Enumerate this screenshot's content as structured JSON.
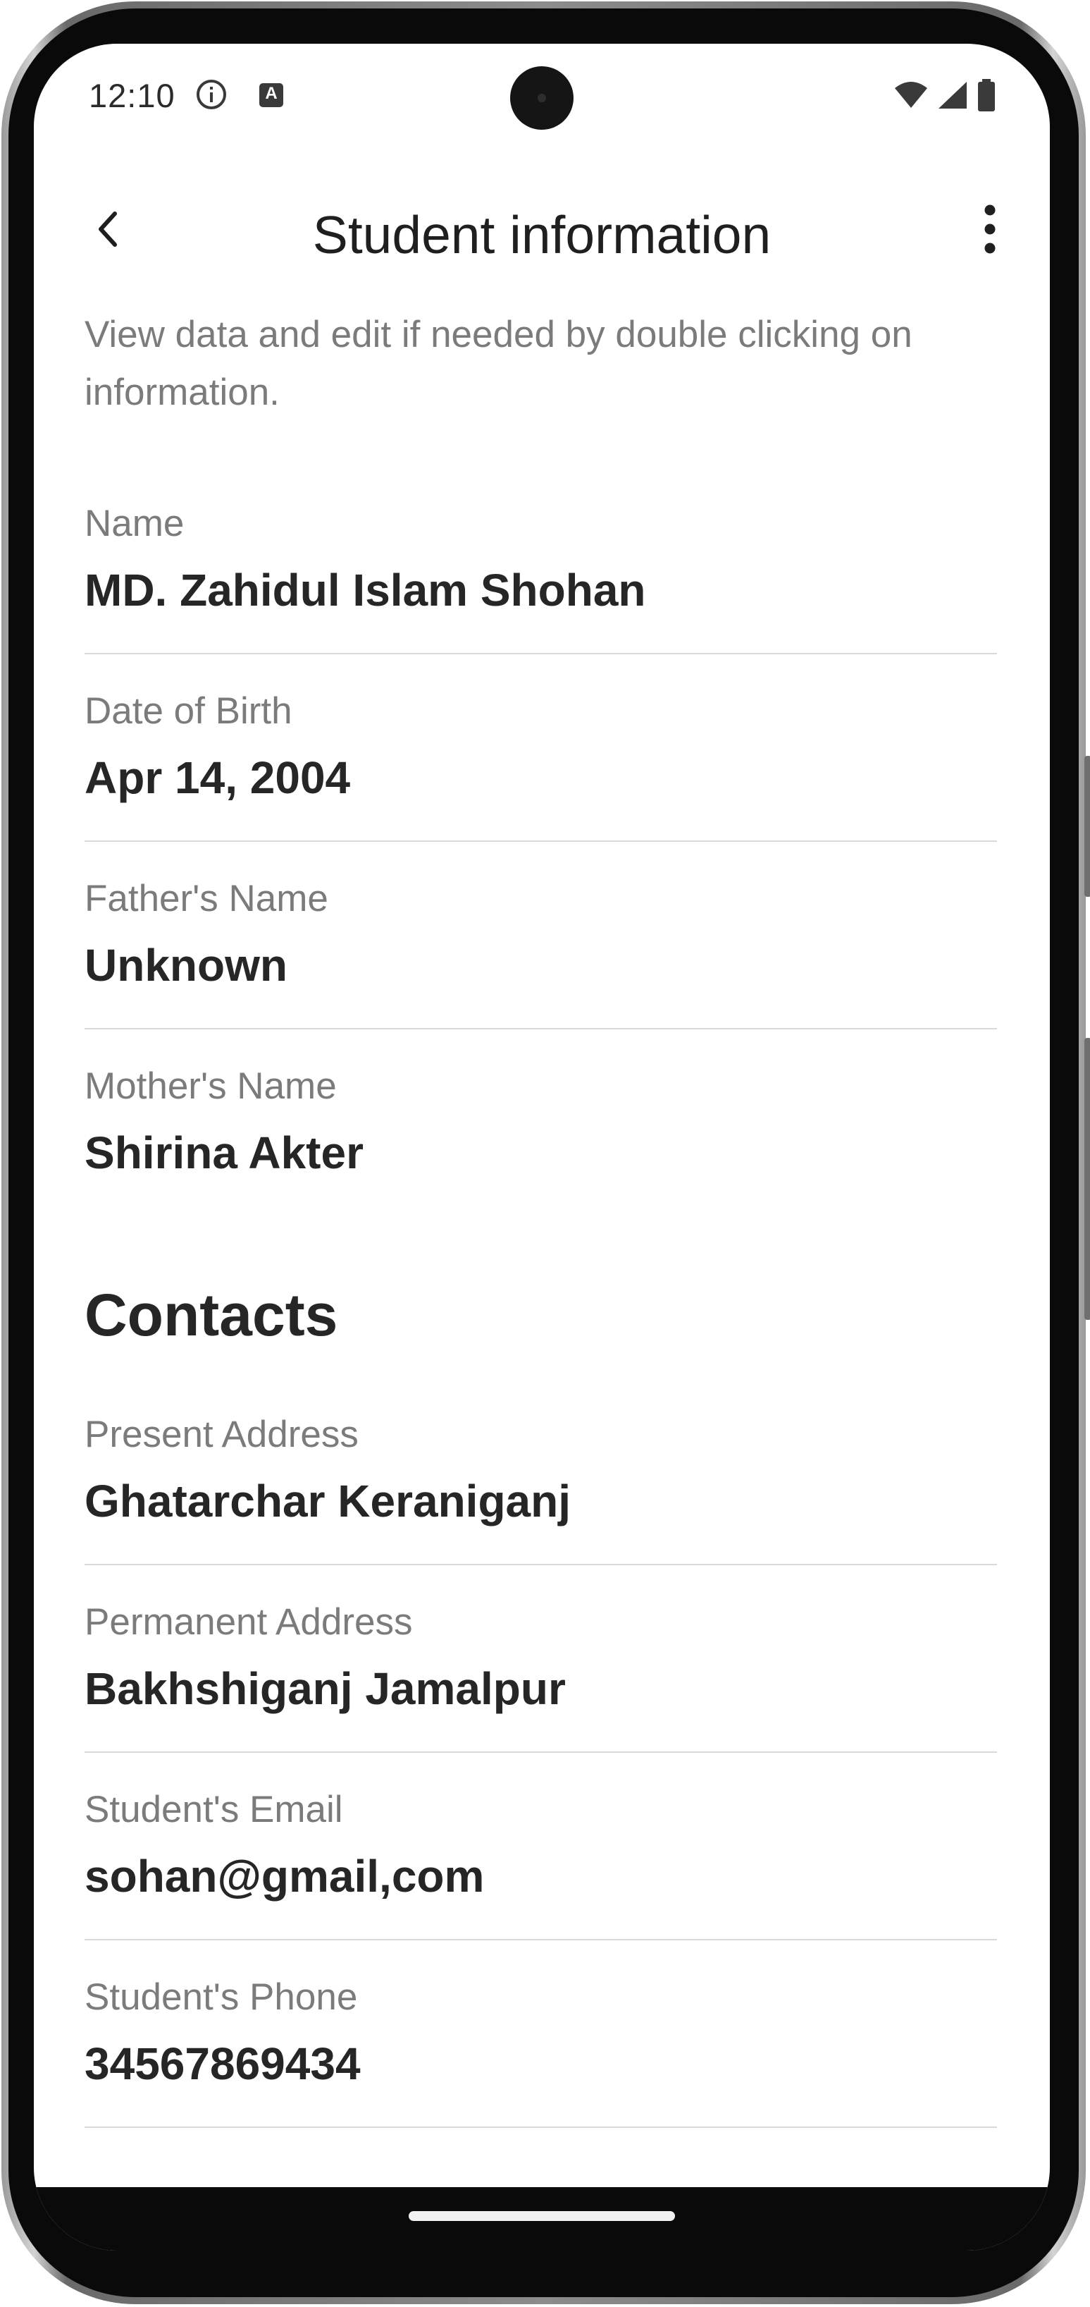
{
  "status_bar": {
    "time": "12:10",
    "icons": [
      "info-icon",
      "a-icon",
      "wifi-icon",
      "signal-icon",
      "battery-icon"
    ]
  },
  "app_bar": {
    "title": "Student information",
    "back_icon": "chevron-left-icon",
    "more_icon": "more-vertical-icon"
  },
  "subtitle": "View data and edit if needed by double clicking on information.",
  "personal": [
    {
      "label": "Name",
      "value": "MD. Zahidul Islam Shohan"
    },
    {
      "label": "Date of Birth",
      "value": "Apr 14, 2004"
    },
    {
      "label": "Father's Name",
      "value": "Unknown"
    },
    {
      "label": "Mother's Name",
      "value": "Shirina Akter"
    }
  ],
  "contacts": {
    "heading": "Contacts",
    "fields": [
      {
        "label": "Present Address",
        "value": "Ghatarchar Keraniganj"
      },
      {
        "label": "Permanent Address",
        "value": "Bakhshiganj Jamalpur"
      },
      {
        "label": "Student's Email",
        "value": "sohan@gmail,com"
      },
      {
        "label": "Student's Phone",
        "value": "34567869434"
      }
    ]
  }
}
